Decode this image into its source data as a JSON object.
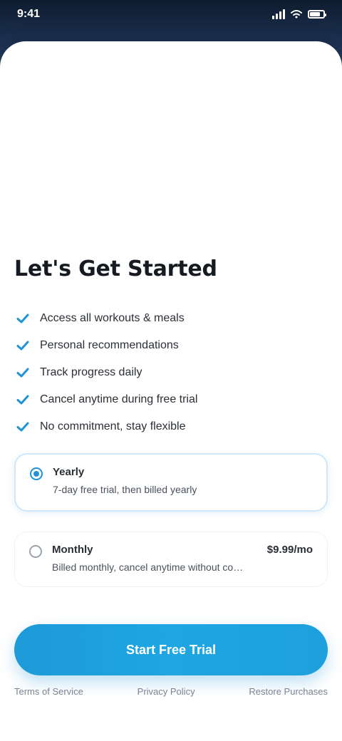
{
  "status_bar": {
    "time": "9:41"
  },
  "screen": {
    "title": "Let's Get Started"
  },
  "features": [
    {
      "icon": "check-icon",
      "label": "Access all workouts & meals"
    },
    {
      "icon": "check-icon",
      "label": "Personal recommendations"
    },
    {
      "icon": "check-icon",
      "label": "Track progress daily"
    },
    {
      "icon": "check-icon",
      "label": "Cancel anytime during free trial"
    },
    {
      "icon": "check-icon",
      "label": "No commitment, stay flexible"
    }
  ],
  "plans": {
    "selected": {
      "name": "Yearly",
      "description": "7-day free trial, then billed yearly"
    },
    "unselected": {
      "name": "Monthly",
      "price": "$9.99/mo",
      "description": "Billed monthly, cancel anytime without commitment"
    }
  },
  "cta": {
    "label": "Start Free Trial"
  },
  "footer": {
    "links": [
      "Terms of Service",
      "Privacy Policy",
      "Restore Purchases"
    ]
  },
  "colors": {
    "accent": "#1f93d8",
    "header_dark": "#1a2f4d"
  }
}
